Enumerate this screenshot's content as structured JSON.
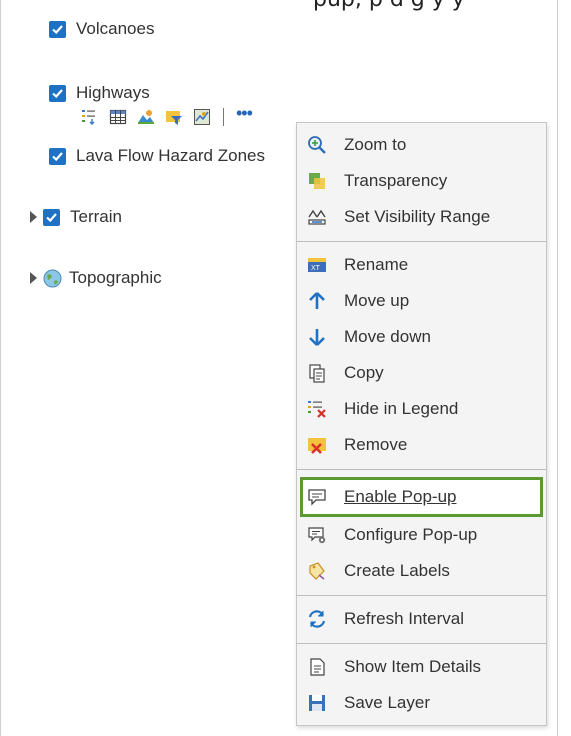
{
  "top_fragment": "pup, p      d  g  y y",
  "layers": [
    {
      "label": "Volcanoes",
      "checked": true
    },
    {
      "label": "Highways",
      "checked": true
    },
    {
      "label": "Lava Flow Hazard Zones",
      "checked": true
    },
    {
      "label": "Terrain",
      "checked": true
    },
    {
      "label": "Topographic",
      "checked": false
    }
  ],
  "toolbar": {
    "icons": [
      "legend-icon",
      "table-icon",
      "style-icon",
      "filter-icon",
      "analysis-icon"
    ],
    "more": "•••"
  },
  "context_menu": {
    "items": [
      {
        "label": "Zoom to",
        "icon": "zoom-to-icon"
      },
      {
        "label": "Transparency",
        "icon": "transparency-icon"
      },
      {
        "label": "Set Visibility Range",
        "icon": "visibility-range-icon"
      },
      {
        "label": "Rename",
        "icon": "rename-icon"
      },
      {
        "label": "Move up",
        "icon": "arrow-up-icon"
      },
      {
        "label": "Move down",
        "icon": "arrow-down-icon"
      },
      {
        "label": "Copy",
        "icon": "copy-icon"
      },
      {
        "label": "Hide in Legend",
        "icon": "hide-legend-icon"
      },
      {
        "label": "Remove",
        "icon": "remove-icon"
      },
      {
        "label": "Enable Pop-up",
        "icon": "popup-icon",
        "highlighted": true
      },
      {
        "label": "Configure Pop-up",
        "icon": "configure-popup-icon"
      },
      {
        "label": "Create Labels",
        "icon": "labels-icon"
      },
      {
        "label": "Refresh Interval",
        "icon": "refresh-icon"
      },
      {
        "label": "Show Item Details",
        "icon": "item-details-icon"
      },
      {
        "label": "Save Layer",
        "icon": "save-icon"
      }
    ]
  },
  "colors": {
    "checkbox": "#1f72c3",
    "highlight_border": "#5a9a2e",
    "menu_bg": "#f4f4f4",
    "arrow_up": "#1f72c3",
    "arrow_down": "#1f72c3"
  }
}
